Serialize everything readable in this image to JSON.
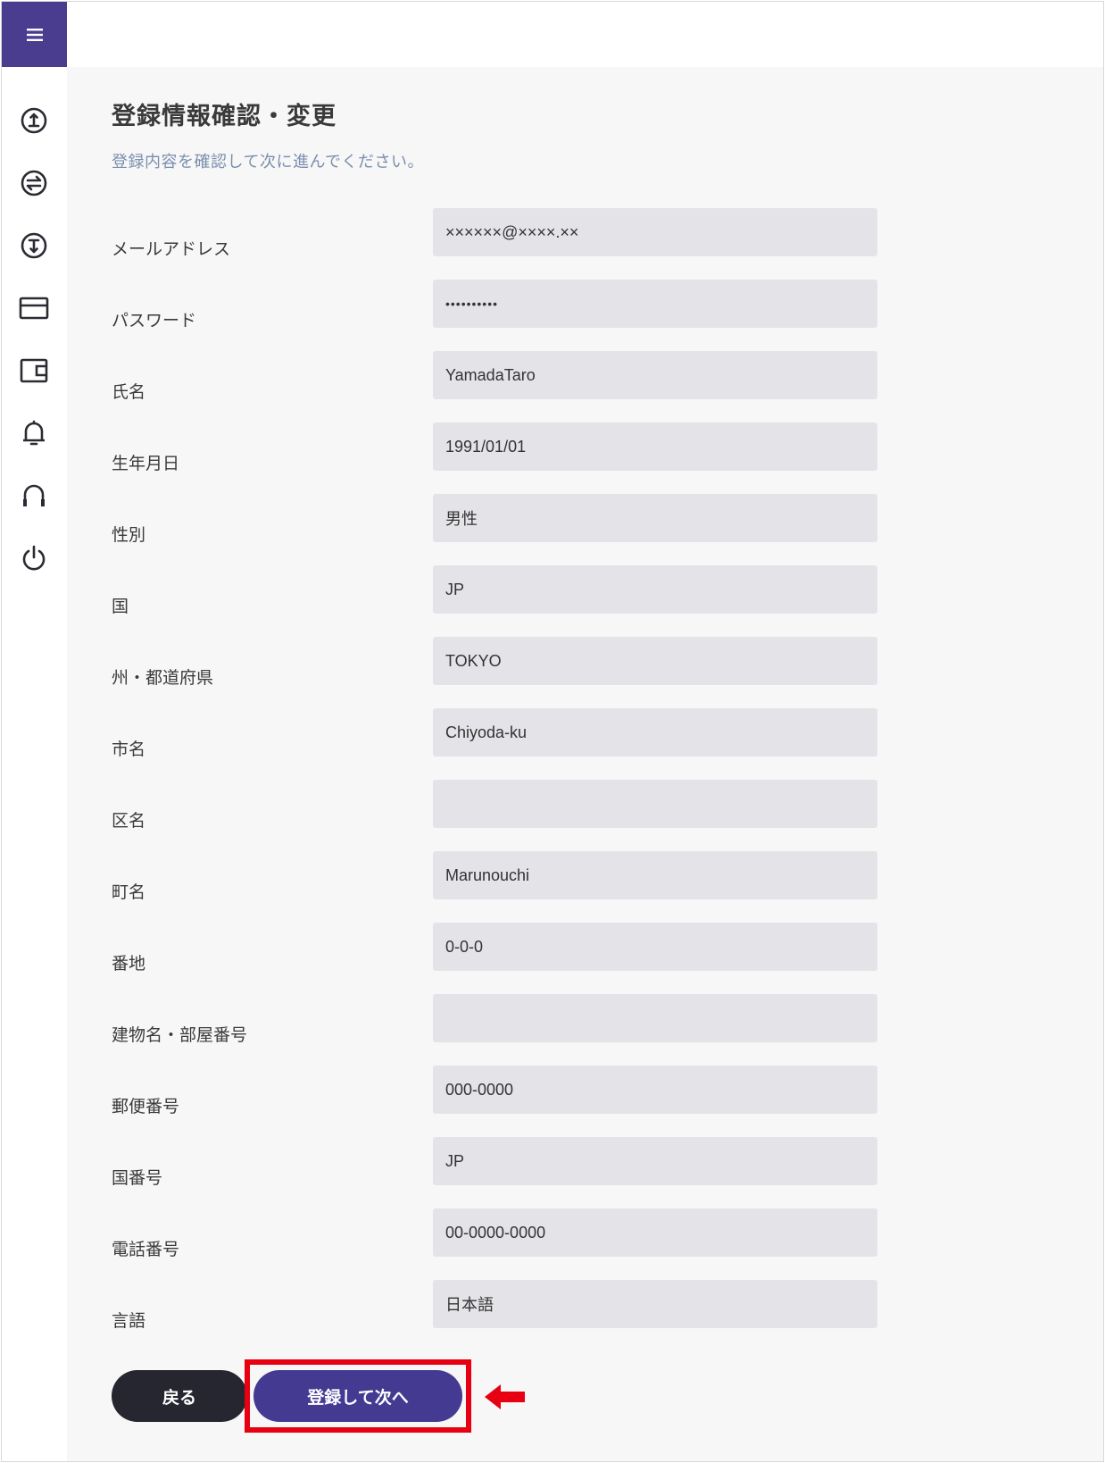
{
  "header": {
    "menu_icon": "hamburger-menu-icon",
    "accent_color": "#4a3d8f"
  },
  "sidebar": {
    "items": [
      {
        "icon": "deposit-icon"
      },
      {
        "icon": "transfer-icon"
      },
      {
        "icon": "withdraw-icon"
      },
      {
        "icon": "card-icon"
      },
      {
        "icon": "wallet-icon"
      },
      {
        "icon": "bell-icon"
      },
      {
        "icon": "headset-icon"
      },
      {
        "icon": "power-icon"
      }
    ]
  },
  "page": {
    "title": "登録情報確認・変更",
    "subtitle": "登録内容を確認して次に進んでください。"
  },
  "fields": [
    {
      "label": "メールアドレス",
      "value": "××××××@××××.××"
    },
    {
      "label": "パスワード",
      "value": "••••••••••"
    },
    {
      "label": "氏名",
      "value": "YamadaTaro"
    },
    {
      "label": "生年月日",
      "value": "1991/01/01"
    },
    {
      "label": "性別",
      "value": "男性"
    },
    {
      "label": "国",
      "value": "JP"
    },
    {
      "label": "州・都道府県",
      "value": "TOKYO"
    },
    {
      "label": "市名",
      "value": "Chiyoda-ku"
    },
    {
      "label": "区名",
      "value": ""
    },
    {
      "label": "町名",
      "value": "Marunouchi"
    },
    {
      "label": "番地",
      "value": "0-0-0"
    },
    {
      "label": "建物名・部屋番号",
      "value": ""
    },
    {
      "label": "郵便番号",
      "value": "000-0000"
    },
    {
      "label": "国番号",
      "value": "JP"
    },
    {
      "label": "電話番号",
      "value": "00-0000-0000"
    },
    {
      "label": "言語",
      "value": "日本語"
    }
  ],
  "actions": {
    "back_label": "戻る",
    "next_label": "登録して次へ",
    "highlight_color": "#e60012"
  }
}
